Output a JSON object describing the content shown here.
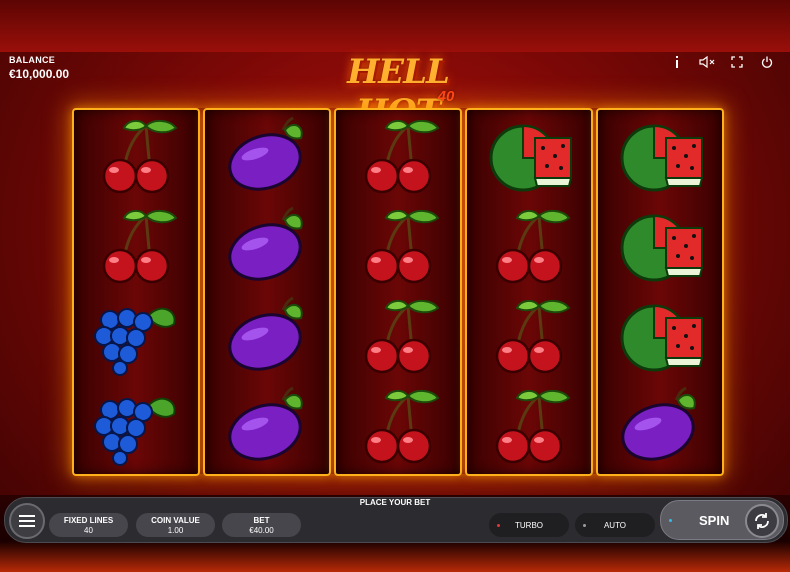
{
  "balance": {
    "label": "BALANCE",
    "value": "€10,000.00"
  },
  "logo": {
    "title": "HELL HOT",
    "number": "40"
  },
  "top_icons": [
    "info-icon",
    "sound-muted-icon",
    "fullscreen-icon",
    "power-icon"
  ],
  "reels": [
    [
      "cherry",
      "cherry",
      "grapes",
      "grapes"
    ],
    [
      "plum",
      "plum",
      "plum",
      "plum"
    ],
    [
      "cherry",
      "cherry",
      "cherry",
      "cherry"
    ],
    [
      "watermelon",
      "cherry",
      "cherry",
      "cherry"
    ],
    [
      "watermelon",
      "watermelon",
      "watermelon",
      "plum"
    ]
  ],
  "controls": {
    "place_bet": "PLACE YOUR BET",
    "fixed_lines": {
      "label": "FIXED LINES",
      "value": "40"
    },
    "coin_value": {
      "label": "COIN VALUE",
      "value": "1.00"
    },
    "bet": {
      "label": "BET",
      "value": "€40.00"
    },
    "turbo": "TURBO",
    "auto": "AUTO",
    "spin": "SPIN"
  },
  "colors": {
    "reel_border": "#ffb11b",
    "turbo_dot": "#e0383a",
    "auto_dot": "#9a9aa0",
    "spin_dot": "#3ab8e8"
  }
}
